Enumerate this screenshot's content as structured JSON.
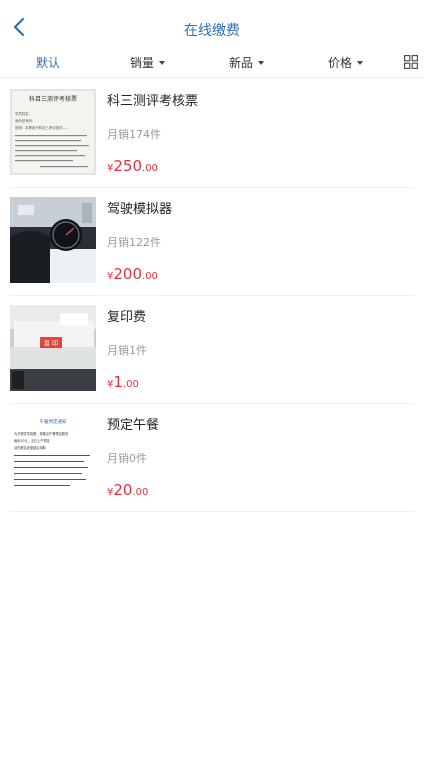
{
  "header": {
    "title": "在线缴费"
  },
  "tabs": [
    {
      "label": "默认",
      "active": true
    },
    {
      "label": "销量"
    },
    {
      "label": "新品"
    },
    {
      "label": "价格"
    }
  ],
  "colors": {
    "accent": "#2f6fb8",
    "price": "#e6303c",
    "muted": "#999999"
  },
  "products": [
    {
      "name": "科三测评考核票",
      "sales": "月销174件",
      "currency": "¥",
      "price_int": "250",
      "price_dec": ".00",
      "thumb_title": "科目三测评考核票",
      "thumb_lines": [
        "学员姓名：",
        "身份证号码：",
        "说明：本票用于科目三考试测评……"
      ]
    },
    {
      "name": "驾驶模拟器",
      "sales": "月销122件",
      "currency": "¥",
      "price_int": "200",
      "price_dec": ".00"
    },
    {
      "name": "复印费",
      "sales": "月销1件",
      "currency": "¥",
      "price_int": "1",
      "price_dec": ".00",
      "thumb_label": "复 印"
    },
    {
      "name": "预定午餐",
      "sales": "月销0件",
      "currency": "¥",
      "price_int": "20",
      "price_dec": ".00",
      "thumb_title": "午餐预定通知",
      "thumb_lines": [
        "为方便学员用餐，现推出午餐预定服务",
        "每份20元，当日上午预定",
        "请在报名处缴费后领取"
      ]
    }
  ]
}
